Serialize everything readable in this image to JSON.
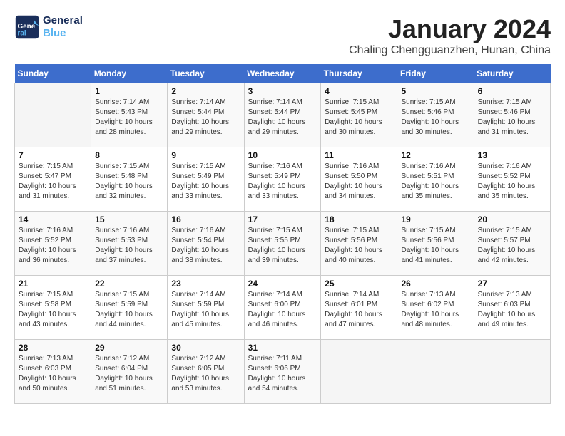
{
  "logo": {
    "line1": "General",
    "line2": "Blue"
  },
  "title": "January 2024",
  "location": "Chaling Chengguanzhen, Hunan, China",
  "weekdays": [
    "Sunday",
    "Monday",
    "Tuesday",
    "Wednesday",
    "Thursday",
    "Friday",
    "Saturday"
  ],
  "weeks": [
    [
      {
        "day": null,
        "sunrise": null,
        "sunset": null,
        "daylight": null
      },
      {
        "day": "1",
        "sunrise": "7:14 AM",
        "sunset": "5:43 PM",
        "daylight": "10 hours and 28 minutes."
      },
      {
        "day": "2",
        "sunrise": "7:14 AM",
        "sunset": "5:44 PM",
        "daylight": "10 hours and 29 minutes."
      },
      {
        "day": "3",
        "sunrise": "7:14 AM",
        "sunset": "5:44 PM",
        "daylight": "10 hours and 29 minutes."
      },
      {
        "day": "4",
        "sunrise": "7:15 AM",
        "sunset": "5:45 PM",
        "daylight": "10 hours and 30 minutes."
      },
      {
        "day": "5",
        "sunrise": "7:15 AM",
        "sunset": "5:46 PM",
        "daylight": "10 hours and 30 minutes."
      },
      {
        "day": "6",
        "sunrise": "7:15 AM",
        "sunset": "5:46 PM",
        "daylight": "10 hours and 31 minutes."
      }
    ],
    [
      {
        "day": "7",
        "sunrise": "7:15 AM",
        "sunset": "5:47 PM",
        "daylight": "10 hours and 31 minutes."
      },
      {
        "day": "8",
        "sunrise": "7:15 AM",
        "sunset": "5:48 PM",
        "daylight": "10 hours and 32 minutes."
      },
      {
        "day": "9",
        "sunrise": "7:15 AM",
        "sunset": "5:49 PM",
        "daylight": "10 hours and 33 minutes."
      },
      {
        "day": "10",
        "sunrise": "7:16 AM",
        "sunset": "5:49 PM",
        "daylight": "10 hours and 33 minutes."
      },
      {
        "day": "11",
        "sunrise": "7:16 AM",
        "sunset": "5:50 PM",
        "daylight": "10 hours and 34 minutes."
      },
      {
        "day": "12",
        "sunrise": "7:16 AM",
        "sunset": "5:51 PM",
        "daylight": "10 hours and 35 minutes."
      },
      {
        "day": "13",
        "sunrise": "7:16 AM",
        "sunset": "5:52 PM",
        "daylight": "10 hours and 35 minutes."
      }
    ],
    [
      {
        "day": "14",
        "sunrise": "7:16 AM",
        "sunset": "5:52 PM",
        "daylight": "10 hours and 36 minutes."
      },
      {
        "day": "15",
        "sunrise": "7:16 AM",
        "sunset": "5:53 PM",
        "daylight": "10 hours and 37 minutes."
      },
      {
        "day": "16",
        "sunrise": "7:16 AM",
        "sunset": "5:54 PM",
        "daylight": "10 hours and 38 minutes."
      },
      {
        "day": "17",
        "sunrise": "7:15 AM",
        "sunset": "5:55 PM",
        "daylight": "10 hours and 39 minutes."
      },
      {
        "day": "18",
        "sunrise": "7:15 AM",
        "sunset": "5:56 PM",
        "daylight": "10 hours and 40 minutes."
      },
      {
        "day": "19",
        "sunrise": "7:15 AM",
        "sunset": "5:56 PM",
        "daylight": "10 hours and 41 minutes."
      },
      {
        "day": "20",
        "sunrise": "7:15 AM",
        "sunset": "5:57 PM",
        "daylight": "10 hours and 42 minutes."
      }
    ],
    [
      {
        "day": "21",
        "sunrise": "7:15 AM",
        "sunset": "5:58 PM",
        "daylight": "10 hours and 43 minutes."
      },
      {
        "day": "22",
        "sunrise": "7:15 AM",
        "sunset": "5:59 PM",
        "daylight": "10 hours and 44 minutes."
      },
      {
        "day": "23",
        "sunrise": "7:14 AM",
        "sunset": "5:59 PM",
        "daylight": "10 hours and 45 minutes."
      },
      {
        "day": "24",
        "sunrise": "7:14 AM",
        "sunset": "6:00 PM",
        "daylight": "10 hours and 46 minutes."
      },
      {
        "day": "25",
        "sunrise": "7:14 AM",
        "sunset": "6:01 PM",
        "daylight": "10 hours and 47 minutes."
      },
      {
        "day": "26",
        "sunrise": "7:13 AM",
        "sunset": "6:02 PM",
        "daylight": "10 hours and 48 minutes."
      },
      {
        "day": "27",
        "sunrise": "7:13 AM",
        "sunset": "6:03 PM",
        "daylight": "10 hours and 49 minutes."
      }
    ],
    [
      {
        "day": "28",
        "sunrise": "7:13 AM",
        "sunset": "6:03 PM",
        "daylight": "10 hours and 50 minutes."
      },
      {
        "day": "29",
        "sunrise": "7:12 AM",
        "sunset": "6:04 PM",
        "daylight": "10 hours and 51 minutes."
      },
      {
        "day": "30",
        "sunrise": "7:12 AM",
        "sunset": "6:05 PM",
        "daylight": "10 hours and 53 minutes."
      },
      {
        "day": "31",
        "sunrise": "7:11 AM",
        "sunset": "6:06 PM",
        "daylight": "10 hours and 54 minutes."
      },
      {
        "day": null,
        "sunrise": null,
        "sunset": null,
        "daylight": null
      },
      {
        "day": null,
        "sunrise": null,
        "sunset": null,
        "daylight": null
      },
      {
        "day": null,
        "sunrise": null,
        "sunset": null,
        "daylight": null
      }
    ]
  ]
}
